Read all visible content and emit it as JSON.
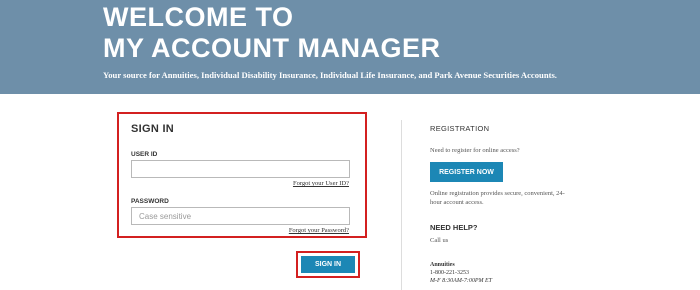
{
  "hero": {
    "title_line1": "WELCOME TO",
    "title_line2": "MY ACCOUNT MANAGER",
    "subtitle": "Your source for Annuities, Individual Disability Insurance, Individual Life Insurance, and Park Avenue Securities Accounts."
  },
  "signin": {
    "title": "SIGN IN",
    "user_id_label": "USER ID",
    "user_id_value": "",
    "user_id_placeholder": "",
    "forgot_user_id": "Forgot your User ID?",
    "password_label": "PASSWORD",
    "password_placeholder": "Case sensitive",
    "forgot_password": "Forgot your Password?",
    "button_label": "SIGN IN"
  },
  "registration": {
    "heading": "REGISTRATION",
    "prompt": "Need to register for online access?",
    "button_label": "REGISTER NOW",
    "description": "Online registration provides secure, convenient, 24-hour account access."
  },
  "help": {
    "heading": "NEED HELP?",
    "call_us": "Call us",
    "annuities_title": "Annuities",
    "annuities_phone": "1-800-221-3253",
    "annuities_hours": "M-F 8:30AM-7:00PM ET"
  },
  "colors": {
    "hero_bg": "#6e8fa9",
    "button_blue": "#1c87b5",
    "highlight_red": "#d32020"
  }
}
